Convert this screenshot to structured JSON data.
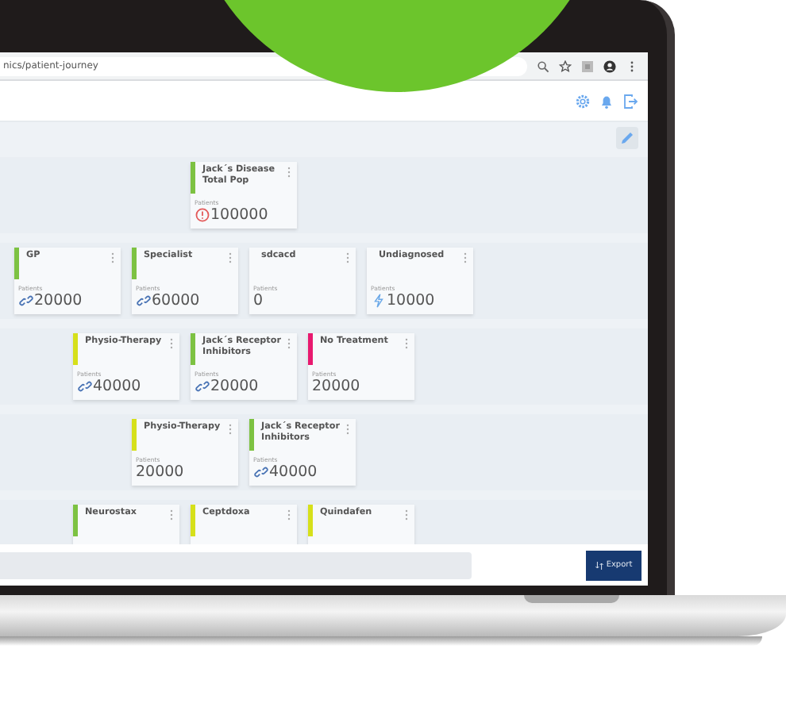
{
  "browser": {
    "url": "nics/patient-journey"
  },
  "levels": [
    {
      "cards": [
        {
          "title": "Jack´s Disease Total Pop",
          "color": "#7dc242",
          "label": "Patients",
          "value": "100000",
          "kind": "alert"
        }
      ]
    },
    {
      "cards": [
        {
          "title": "GP",
          "color": "#7dc242",
          "label": "Patients",
          "value": "20000",
          "kind": "link"
        },
        {
          "title": "Specialist",
          "color": "#7dc242",
          "label": "Patients",
          "value": "60000",
          "kind": "link"
        },
        {
          "title": "sdcacd",
          "label": "Patients",
          "value": "0",
          "kind": "plain"
        },
        {
          "title": "Undiagnosed",
          "label": "Patients",
          "value": "10000",
          "kind": "bolt"
        }
      ]
    },
    {
      "cards": [
        {
          "title": "Physio-Therapy",
          "color": "#d6e01a",
          "label": "Patients",
          "value": "40000",
          "kind": "link"
        },
        {
          "title": "Jack´s Receptor Inhibitors",
          "color": "#7dc242",
          "label": "Patients",
          "value": "20000",
          "kind": "link"
        },
        {
          "title": "No Treatment",
          "color": "#e8196f",
          "label": "Patients",
          "value": "20000",
          "kind": "plain"
        }
      ]
    },
    {
      "cards": [
        {
          "title": "Physio-Therapy",
          "color": "#d6e01a",
          "label": "Patients",
          "value": "20000",
          "kind": "plain"
        },
        {
          "title": "Jack´s Receptor Inhibitors",
          "color": "#7dc242",
          "label": "Patients",
          "value": "40000",
          "kind": "link"
        }
      ]
    },
    {
      "cards": [
        {
          "title": "Neurostax",
          "color": "#7dc242"
        },
        {
          "title": "Ceptdoxa",
          "color": "#d6e01a"
        },
        {
          "title": "Quindafen",
          "color": "#d6e01a"
        }
      ]
    }
  ],
  "footer": {
    "export_button": "Export"
  }
}
